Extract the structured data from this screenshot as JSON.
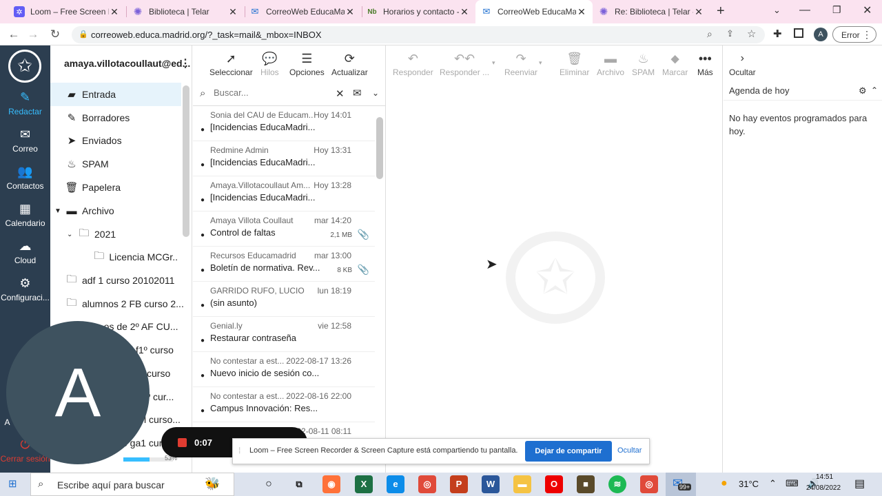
{
  "browser": {
    "tabs": [
      {
        "title": "Loom – Free Screen Re",
        "icon": "loom-icon",
        "color": "#625df5"
      },
      {
        "title": "Biblioteca | Telar",
        "icon": "telar-icon",
        "color": "#7b61d9"
      },
      {
        "title": "CorreoWeb EducaMa",
        "icon": "mail-icon",
        "color": "#1e6fd0"
      },
      {
        "title": "Horarios y contacto -",
        "icon": "nb-icon",
        "color": "#4a7b2a"
      },
      {
        "title": "CorreoWeb EducaMa",
        "icon": "mail-icon",
        "color": "#1e6fd0"
      },
      {
        "title": "Re: Biblioteca | Telar -",
        "icon": "telar-icon",
        "color": "#7b61d9"
      }
    ],
    "url": "correoweb.educa.madrid.org/?_task=mail&_mbox=INBOX",
    "profile_initial": "A",
    "error_label": "Error"
  },
  "appnav": {
    "items": [
      {
        "label": "Redactar",
        "icon": "compose-icon"
      },
      {
        "label": "Correo",
        "icon": "mail-icon"
      },
      {
        "label": "Contactos",
        "icon": "contacts-icon"
      },
      {
        "label": "Calendario",
        "icon": "calendar-icon"
      },
      {
        "label": "Cloud",
        "icon": "cloud-icon"
      },
      {
        "label": "Configuraci...",
        "icon": "gear-icon"
      }
    ],
    "logout_label": "Cerrar sesión",
    "partial_label": "A"
  },
  "account": {
    "email": "amaya.villotacoullaut@ed..."
  },
  "folders": [
    {
      "label": "Entrada",
      "icon": "inbox-icon",
      "active": true
    },
    {
      "label": "Borradores",
      "icon": "pencil-icon"
    },
    {
      "label": "Enviados",
      "icon": "send-icon"
    },
    {
      "label": "SPAM",
      "icon": "fire-icon"
    },
    {
      "label": "Papelera",
      "icon": "trash-icon"
    },
    {
      "label": "Archivo",
      "icon": "archive-icon"
    },
    {
      "label": "2021",
      "icon": "folder-icon"
    },
    {
      "label": "Licencia MCGr...",
      "icon": "folder-icon"
    },
    {
      "label": "adf 1 curso 20102011",
      "icon": "folder-icon"
    },
    {
      "label": "alumnos 2 FB curso 2...",
      "icon": "folder-icon"
    },
    {
      "label": "...os de 2º AF CU..."
    },
    {
      "label": "f1º curso"
    },
    {
      "label": "curso"
    },
    {
      "label": "º cur..."
    },
    {
      "label": "l curso..."
    },
    {
      "label": "e ga1 cur"
    }
  ],
  "quota": "53%",
  "list_toolbar": {
    "select": "Seleccionar",
    "threads": "Hilos",
    "options": "Opciones",
    "refresh": "Actualizar"
  },
  "search": {
    "placeholder": "Buscar..."
  },
  "messages": [
    {
      "from": "Sonia del CAU de Educam...",
      "date": "Hoy 14:01",
      "subject": "[Incidencias EducaMadri...",
      "size": "",
      "attach": false
    },
    {
      "from": "Redmine Admin",
      "date": "Hoy 13:31",
      "subject": "[Incidencias EducaMadri...",
      "size": "",
      "attach": false
    },
    {
      "from": "Amaya.Villotacoullaut Am...",
      "date": "Hoy 13:28",
      "subject": "[Incidencias EducaMadri...",
      "size": "",
      "attach": false
    },
    {
      "from": "Amaya Villota Coullaut",
      "date": "mar 14:20",
      "subject": "Control de faltas",
      "size": "2,1 MB",
      "attach": true
    },
    {
      "from": "Recursos Educamadrid",
      "date": "mar 13:00",
      "subject": "Boletín de normativa. Rev...",
      "size": "8 KB",
      "attach": true
    },
    {
      "from": "GARRIDO RUFO, LUCIO",
      "date": "lun 18:19",
      "subject": "(sin asunto)",
      "size": "",
      "attach": false
    },
    {
      "from": "Genial.ly",
      "date": "vie 12:58",
      "subject": "Restaurar contraseña",
      "size": "",
      "attach": false
    },
    {
      "from": "No contestar a est...",
      "date": "2022-08-17 13:26",
      "subject": "Nuevo inicio de sesión co...",
      "size": "",
      "attach": false
    },
    {
      "from": "No contestar a est...",
      "date": "2022-08-16 22:00",
      "subject": "Campus Innovación: Res...",
      "size": "",
      "attach": false
    },
    {
      "from": "",
      "date": "2022-08-11 08:11",
      "subject": "",
      "size": "",
      "attach": false
    }
  ],
  "content_toolbar": {
    "reply": "Responder",
    "reply_all": "Responder ...",
    "forward": "Reenviar",
    "delete": "Eliminar",
    "archive": "Archivo",
    "spam": "SPAM",
    "mark": "Marcar",
    "more": "Más",
    "hide": "Ocultar"
  },
  "agenda": {
    "title": "Agenda de hoy",
    "empty": "No hay eventos programados para hoy."
  },
  "recording": {
    "time": "0:07",
    "avatar_letter": "A"
  },
  "share_bar": {
    "message": "Loom – Free Screen Recorder & Screen Capture está compartiendo tu pantalla.",
    "stop": "Dejar de compartir",
    "hide": "Ocultar"
  },
  "taskbar": {
    "search_placeholder": "Escribe aquí para buscar",
    "weather": "31°C",
    "time": "14:51",
    "date": "24/08/2022",
    "notifications": "99+"
  },
  "colors": {
    "sidebar": "#2c3e50",
    "accent": "#37beff",
    "primary_button": "#1e6fd0",
    "rec": "#e03c31"
  }
}
